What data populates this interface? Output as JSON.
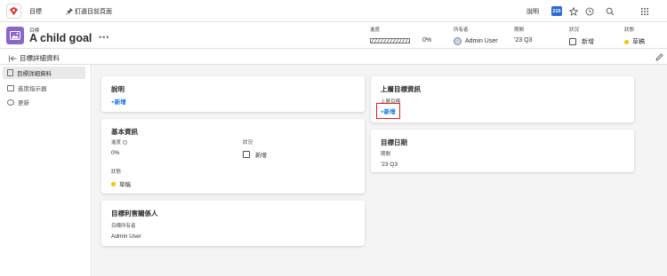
{
  "topbar": {
    "nav_goals": "目標",
    "nav_pin": "釘選目前頁面",
    "help": "說明",
    "notification_count": "215"
  },
  "header": {
    "type_label": "目標",
    "title": "A child goal",
    "more": "•••",
    "progress_label": "進度",
    "progress_value": "0%",
    "progress_fraction": 0,
    "owner_label": "所有者",
    "owner_value": "Admin User",
    "period_label": "期間",
    "period_value": "'23 Q3",
    "state_label": "狀況",
    "state_value": "新增",
    "status_label": "狀態",
    "status_value": "草稿",
    "status_color": "#f0c400"
  },
  "subheader": {
    "title": "目標詳細資料"
  },
  "sidebar": {
    "items": [
      {
        "label": "目標詳細資料"
      },
      {
        "label": "進度指示器"
      },
      {
        "label": "更新"
      }
    ]
  },
  "cards": {
    "description": {
      "title": "說明",
      "add": "+新增"
    },
    "basic": {
      "title": "基本資訊",
      "progress_label": "進度",
      "progress_value": "0%",
      "state_label": "狀況",
      "state_value": "新增",
      "status_label": "狀態",
      "status_value": "草稿"
    },
    "stakeholders": {
      "title": "目標利害關係人",
      "owner_label": "目標所有者",
      "owner_value": "Admin User"
    },
    "parent": {
      "title": "上層目標資訊",
      "parent_label": "上層目標",
      "add": "+新增"
    },
    "dates": {
      "title": "目標日期",
      "period_label": "期間",
      "period_value": "'23 Q3"
    }
  },
  "colors": {
    "accent": "#1473e6",
    "goal_icon": "#8b66c9",
    "highlight": "#e02020"
  }
}
